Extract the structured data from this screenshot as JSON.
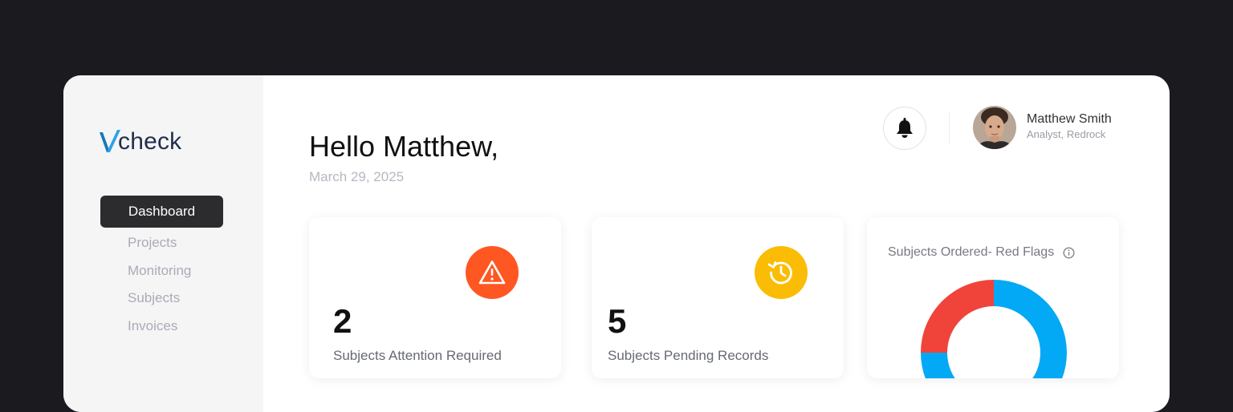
{
  "brand": {
    "logo_text": "check"
  },
  "sidebar": {
    "items": [
      {
        "label": "Dashboard",
        "active": true
      },
      {
        "label": "Projects"
      },
      {
        "label": "Monitoring"
      },
      {
        "label": "Subjects"
      },
      {
        "label": "Invoices"
      }
    ]
  },
  "header": {
    "greeting": "Hello Matthew,",
    "date": "March 29, 2025",
    "bell_icon": "bell-icon",
    "user": {
      "name": "Matthew Smith",
      "role": "Analyst, Redrock"
    }
  },
  "cards": [
    {
      "value": "2",
      "label": "Subjects Attention Required",
      "icon": "warning-icon",
      "color": "#ff5722"
    },
    {
      "value": "5",
      "label": "Subjects Pending Records",
      "icon": "history-icon",
      "color": "#fbbc05"
    }
  ],
  "chart_card": {
    "title": "Subjects Ordered- Red Flags",
    "info_icon": "info-icon"
  },
  "chart_data": {
    "type": "pie",
    "title": "Subjects Ordered- Red Flags",
    "series": [
      {
        "value": 25,
        "color": "#f0433a"
      },
      {
        "value": 75,
        "color": "#03a9f4"
      }
    ]
  },
  "colors": {
    "accent_blue": "#03a9f4",
    "accent_red": "#f0433a",
    "accent_orange": "#ff5722",
    "accent_yellow": "#fbbc05",
    "nav_active": "#2c2c2e"
  }
}
